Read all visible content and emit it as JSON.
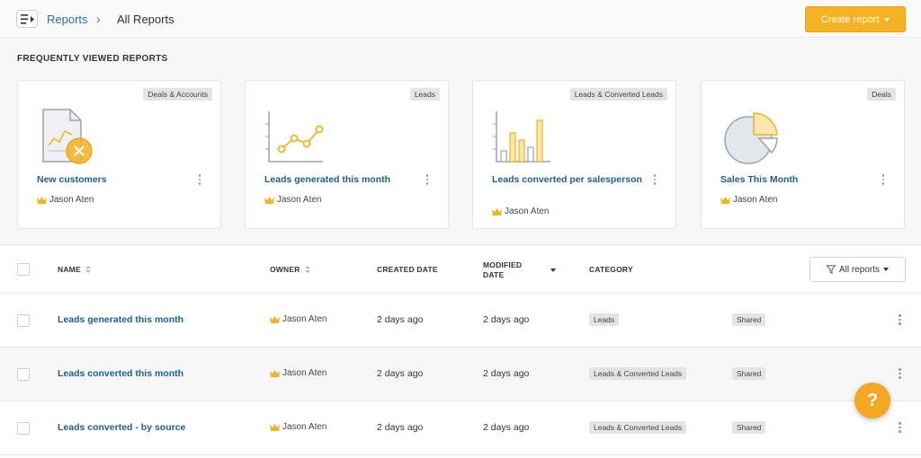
{
  "header": {
    "breadcrumb_link": "Reports",
    "breadcrumb_sep": "›",
    "breadcrumb_current": "All Reports",
    "create_label": "Create report"
  },
  "frequently_viewed": {
    "title": "FREQUENTLY VIEWED REPORTS",
    "cards": [
      {
        "badge": "Deals & Accounts",
        "title": "New customers",
        "owner": "Jason Aten",
        "icon": "document-chart-cancel-icon"
      },
      {
        "badge": "Leads",
        "title": "Leads generated this month",
        "owner": "Jason Aten",
        "icon": "line-chart-icon"
      },
      {
        "badge": "Leads & Converted Leads",
        "title": "Leads converted per salesperson",
        "owner": "Jason Aten",
        "icon": "bar-chart-icon"
      },
      {
        "badge": "Deals",
        "title": "Sales This Month",
        "owner": "Jason Aten",
        "icon": "pie-chart-icon"
      }
    ]
  },
  "table": {
    "columns": {
      "name": "NAME",
      "owner": "OWNER",
      "created": "CREATED DATE",
      "modified": "MODIFIED DATE",
      "category": "CATEGORY"
    },
    "filter_label": "All reports",
    "rows": [
      {
        "name": "Leads generated this month",
        "owner": "Jason Aten",
        "created": "2 days ago",
        "modified": "2 days ago",
        "category": "Leads",
        "sharing": "Shared"
      },
      {
        "name": "Leads converted this month",
        "owner": "Jason Aten",
        "created": "2 days ago",
        "modified": "2 days ago",
        "category": "Leads & Converted Leads",
        "sharing": "Shared"
      },
      {
        "name": "Leads converted - by source",
        "owner": "Jason Aten",
        "created": "2 days ago",
        "modified": "2 days ago",
        "category": "Leads & Converted Leads",
        "sharing": "Shared"
      }
    ]
  },
  "help": {
    "label": "?"
  },
  "colors": {
    "accent": "#f5b225",
    "link": "#1f5e8c",
    "crown": "#f0b429"
  }
}
